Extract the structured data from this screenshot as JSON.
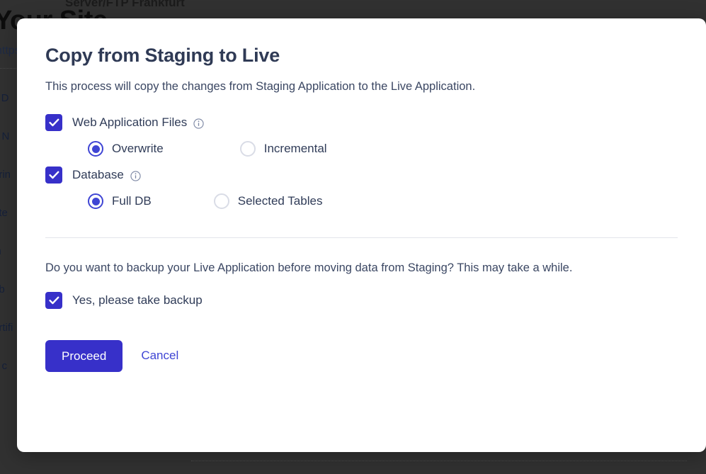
{
  "background": {
    "top_strip_text": "Server/FTP   Frankfurt",
    "heading": "Your Site",
    "url_text": "https://",
    "list_items": [
      "s D",
      "g N",
      "orin",
      "ote",
      "in",
      "ob",
      "ertifi",
      "p c"
    ]
  },
  "modal": {
    "title": "Copy from Staging to Live",
    "subtitle": "This process will copy the changes from Staging Application to the Live Application.",
    "options": [
      {
        "id": "web-application-files",
        "label": "Web Application Files",
        "checked": true,
        "info_icon": "info-icon",
        "radios": [
          {
            "id": "overwrite",
            "label": "Overwrite",
            "selected": true
          },
          {
            "id": "incremental",
            "label": "Incremental",
            "selected": false
          }
        ]
      },
      {
        "id": "database",
        "label": "Database",
        "checked": true,
        "info_icon": "info-icon",
        "radios": [
          {
            "id": "full-db",
            "label": "Full DB",
            "selected": true
          },
          {
            "id": "selected-tables",
            "label": "Selected Tables",
            "selected": false
          }
        ]
      }
    ],
    "backup": {
      "question": "Do you want to backup your Live Application before moving data from Staging? This may take a while.",
      "checkbox_label": "Yes, please take backup",
      "checked": true
    },
    "actions": {
      "proceed_label": "Proceed",
      "cancel_label": "Cancel"
    }
  },
  "colors": {
    "accent": "#3730c9",
    "accent_light": "#3f45d4",
    "text": "#303c58",
    "muted": "#3b4763",
    "border": "#e3e5ea",
    "radio_off": "#d9dce6",
    "backdrop": "#313131"
  }
}
